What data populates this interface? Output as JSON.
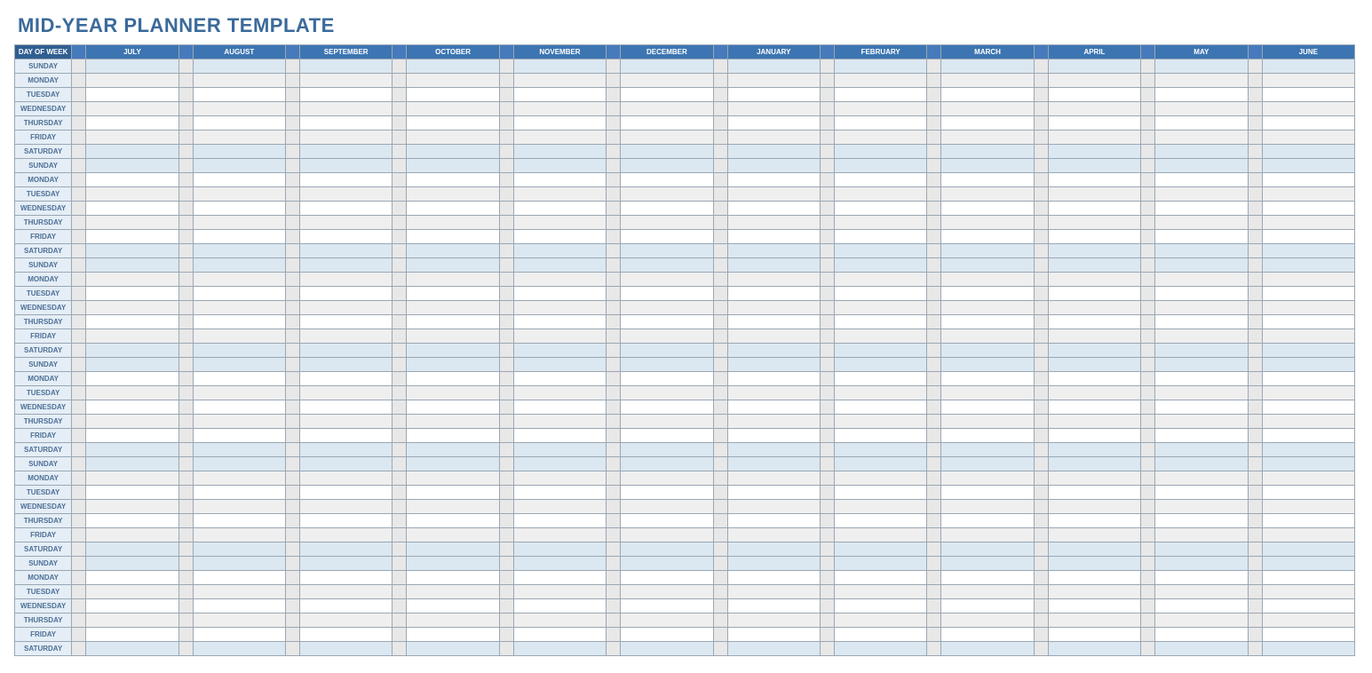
{
  "title": "MID-YEAR PLANNER TEMPLATE",
  "header": {
    "day_label": "DAY OF WEEK",
    "months": [
      "JULY",
      "AUGUST",
      "SEPTEMBER",
      "OCTOBER",
      "NOVEMBER",
      "DECEMBER",
      "JANUARY",
      "FEBRUARY",
      "MARCH",
      "APRIL",
      "MAY",
      "JUNE"
    ]
  },
  "days_sequence": [
    "SUNDAY",
    "MONDAY",
    "TUESDAY",
    "WEDNESDAY",
    "THURSDAY",
    "FRIDAY",
    "SATURDAY",
    "SUNDAY",
    "MONDAY",
    "TUESDAY",
    "WEDNESDAY",
    "THURSDAY",
    "FRIDAY",
    "SATURDAY",
    "SUNDAY",
    "MONDAY",
    "TUESDAY",
    "WEDNESDAY",
    "THURSDAY",
    "FRIDAY",
    "SATURDAY",
    "SUNDAY",
    "MONDAY",
    "TUESDAY",
    "WEDNESDAY",
    "THURSDAY",
    "FRIDAY",
    "SATURDAY",
    "SUNDAY",
    "MONDAY",
    "TUESDAY",
    "WEDNESDAY",
    "THURSDAY",
    "FRIDAY",
    "SATURDAY",
    "SUNDAY",
    "MONDAY",
    "TUESDAY",
    "WEDNESDAY",
    "THURSDAY",
    "FRIDAY",
    "SATURDAY"
  ],
  "weekend_days": [
    "SUNDAY",
    "SATURDAY"
  ]
}
